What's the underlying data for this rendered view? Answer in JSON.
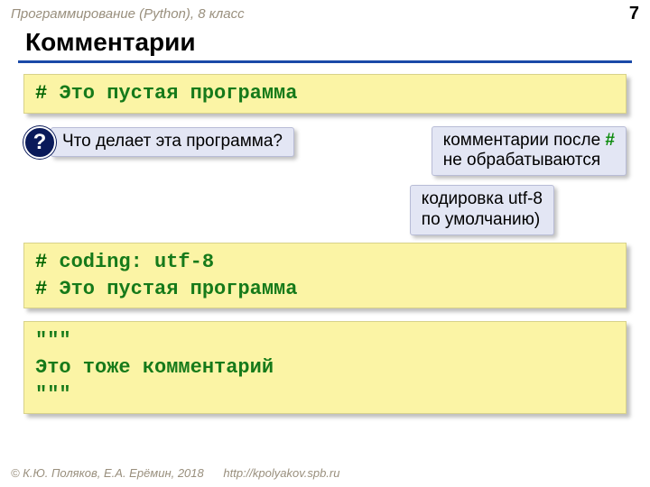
{
  "header": {
    "course": "Программирование (Python), 8 класс",
    "page": "7"
  },
  "title": "Комментарии",
  "code1": {
    "hash": "#",
    "text": " Это пустая программа"
  },
  "question": {
    "mark": "?",
    "text": "Что делает эта программа?"
  },
  "callout_hash": {
    "prefix": "комментарии после ",
    "hash": "#",
    "suffix": "не обрабатываются"
  },
  "callout_utf": {
    "line1": "кодировка utf-8",
    "line2": "по умолчанию)"
  },
  "code2": {
    "line1_hash": "#",
    "line1_text": " coding: utf-8",
    "line2_hash": "#",
    "line2_text": " Это пустая программа"
  },
  "code3": {
    "open": "\"\"\"",
    "body": "Это тоже комментарий",
    "close": "\"\"\""
  },
  "footer": {
    "authors": "© К.Ю. Поляков, Е.А. Ерёмин, 2018",
    "url": "http://kpolyakov.spb.ru"
  }
}
